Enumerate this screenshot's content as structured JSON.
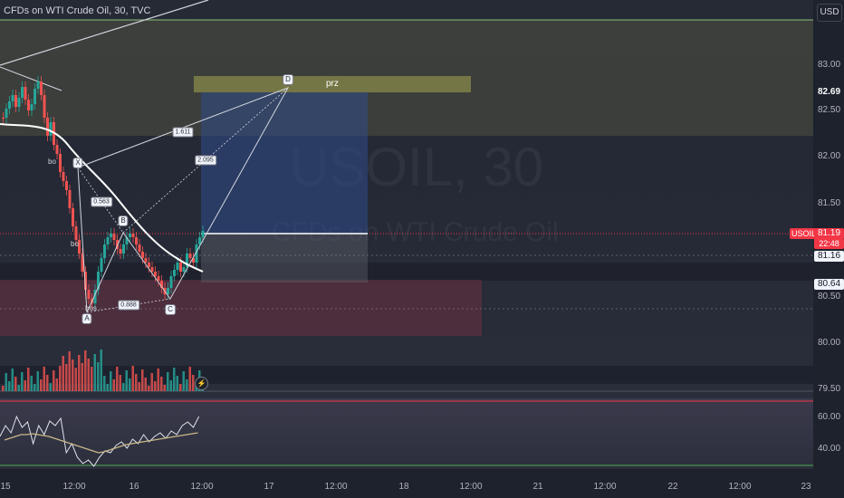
{
  "header": {
    "title": "CFDs on WTI Crude Oil, 30, TVC",
    "currency": "USD"
  },
  "watermark": {
    "symbol": "USOIL, 30",
    "description": "CFDs on WTI Crude Oil"
  },
  "price_axis": {
    "ticks": [
      "83.00",
      "82.50",
      "82.00",
      "81.50",
      "80.50",
      "80.00",
      "79.50"
    ],
    "labels": {
      "prz_top": "82.69",
      "symbol_tag": "USOIL",
      "last_price": "81.19",
      "countdown": "22:48",
      "line_a": "81.16",
      "line_b": "80.64"
    }
  },
  "rsi_axis": {
    "ticks": [
      "60.00",
      "40.00"
    ]
  },
  "time_axis": {
    "ticks": [
      "15",
      "12:00",
      "16",
      "12:00",
      "17",
      "12:00",
      "18",
      "12:00",
      "21",
      "12:00",
      "22",
      "12:00",
      "23"
    ]
  },
  "pattern": {
    "points": {
      "x": "X",
      "a": "A",
      "b": "B",
      "c": "C",
      "d": "D"
    },
    "ratios": {
      "xb": "0.563",
      "ac": "0.888",
      "bd": "2.095",
      "xd": "1.611"
    },
    "zone_label": "prz"
  },
  "annotations": {
    "bo_1": "bo",
    "bo_2": "bo",
    "bos": "bos"
  },
  "colors": {
    "background": "#1e222d",
    "up_candle": "#26a69a",
    "down_candle": "#ef5350",
    "last_price": "#f23645",
    "prz_zone": "#8a8a4a",
    "sell_zone": "#7a3044",
    "blue_box": "#2f4a8a"
  },
  "icons": {
    "replay": "bolt-icon"
  }
}
